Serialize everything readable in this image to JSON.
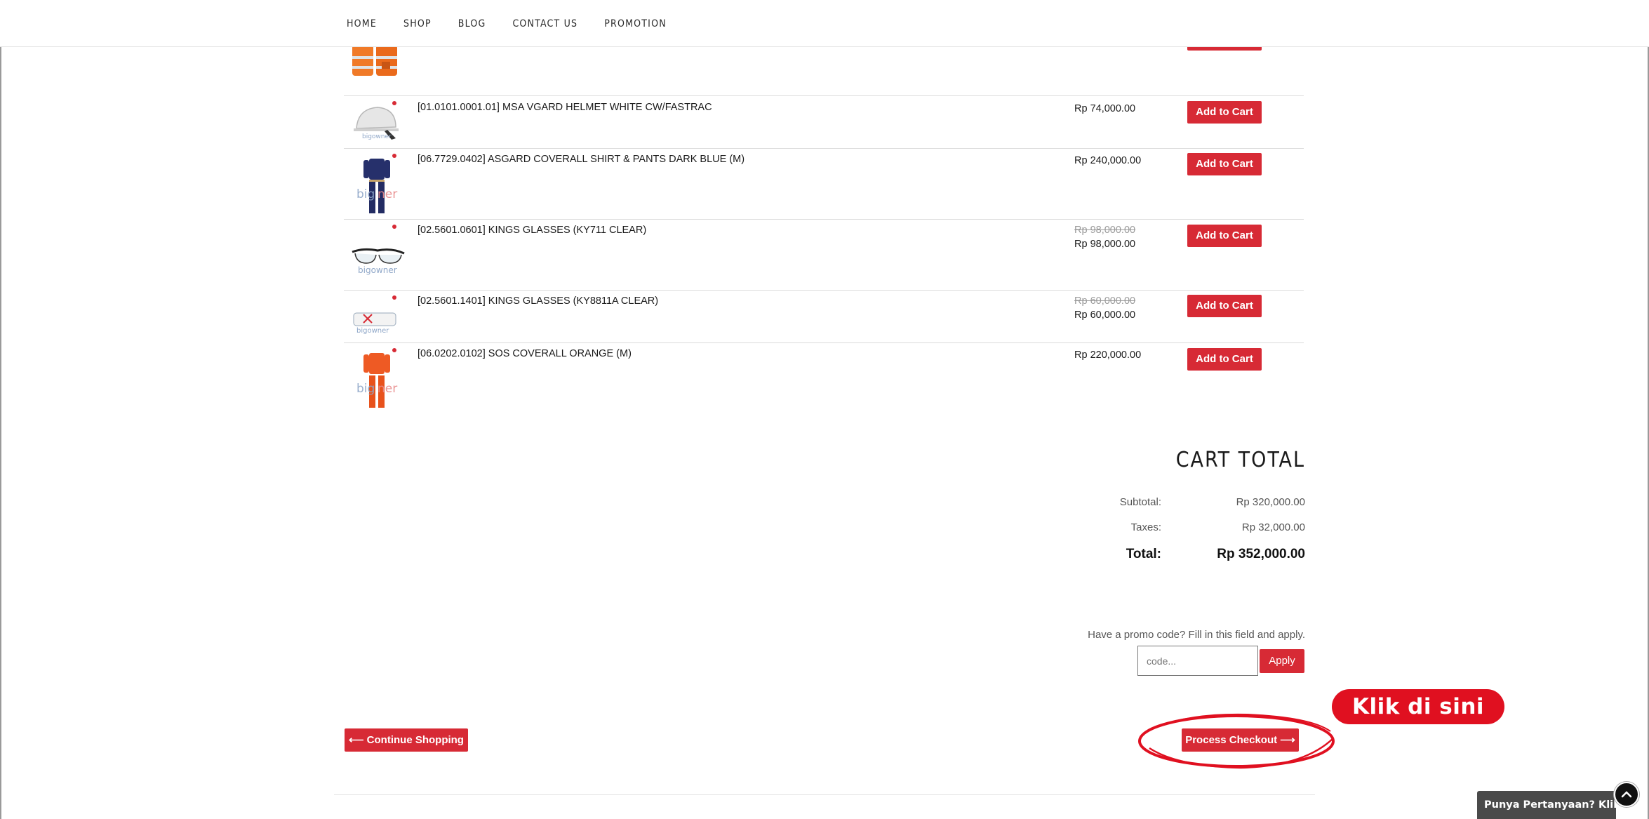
{
  "nav": {
    "links": [
      "HOME",
      "SHOP",
      "BLOG",
      "CONTACT US",
      "PROMOTION"
    ]
  },
  "products": [
    {
      "name": "[01.0101.0001.01] MSA VGARD HELMET WHITE CW/FASTRAC",
      "price": "Rp 74,000.00",
      "old_price": "",
      "add_label": "Add to Cart",
      "icon": "helmet-image"
    },
    {
      "name": "[06.7729.0402] ASGARD COVERALL SHIRT & PANTS DARK BLUE (M)",
      "price": "Rp 240,000.00",
      "old_price": "",
      "add_label": "Add to Cart",
      "icon": "coverall-blue-image"
    },
    {
      "name": "[02.5601.0601] KINGS GLASSES (KY711 CLEAR)",
      "price": "Rp 98,000.00",
      "old_price": "Rp 98,000.00",
      "add_label": "Add to Cart",
      "icon": "glasses-image"
    },
    {
      "name": "[02.5601.1401] KINGS GLASSES (KY8811A CLEAR)",
      "price": "Rp 60,000.00",
      "old_price": "Rp 60,000.00",
      "add_label": "Add to Cart",
      "icon": "glasses-image"
    },
    {
      "name": "[06.0202.0102] SOS COVERALL ORANGE (M)",
      "price": "Rp 220,000.00",
      "old_price": "",
      "add_label": "Add to Cart",
      "icon": "coverall-orange-image"
    }
  ],
  "cart": {
    "title": "CART TOTAL",
    "subtotal_label": "Subtotal:",
    "subtotal": "Rp 320,000.00",
    "taxes_label": "Taxes:",
    "taxes": "Rp 32,000.00",
    "total_label": "Total:",
    "total": "Rp 352,000.00"
  },
  "promo": {
    "text": "Have a promo code? Fill in this field and apply.",
    "placeholder": "code...",
    "apply_label": "Apply"
  },
  "actions": {
    "continue_label": "⟵ Continue Shopping",
    "checkout_label": "Process Checkout ⟶",
    "callout": "Klik di sini"
  },
  "chat": {
    "label": "Punya Pertanyaan? Klik di sini"
  },
  "colors": {
    "accent": "#d72a35",
    "callout": "#e01020"
  }
}
